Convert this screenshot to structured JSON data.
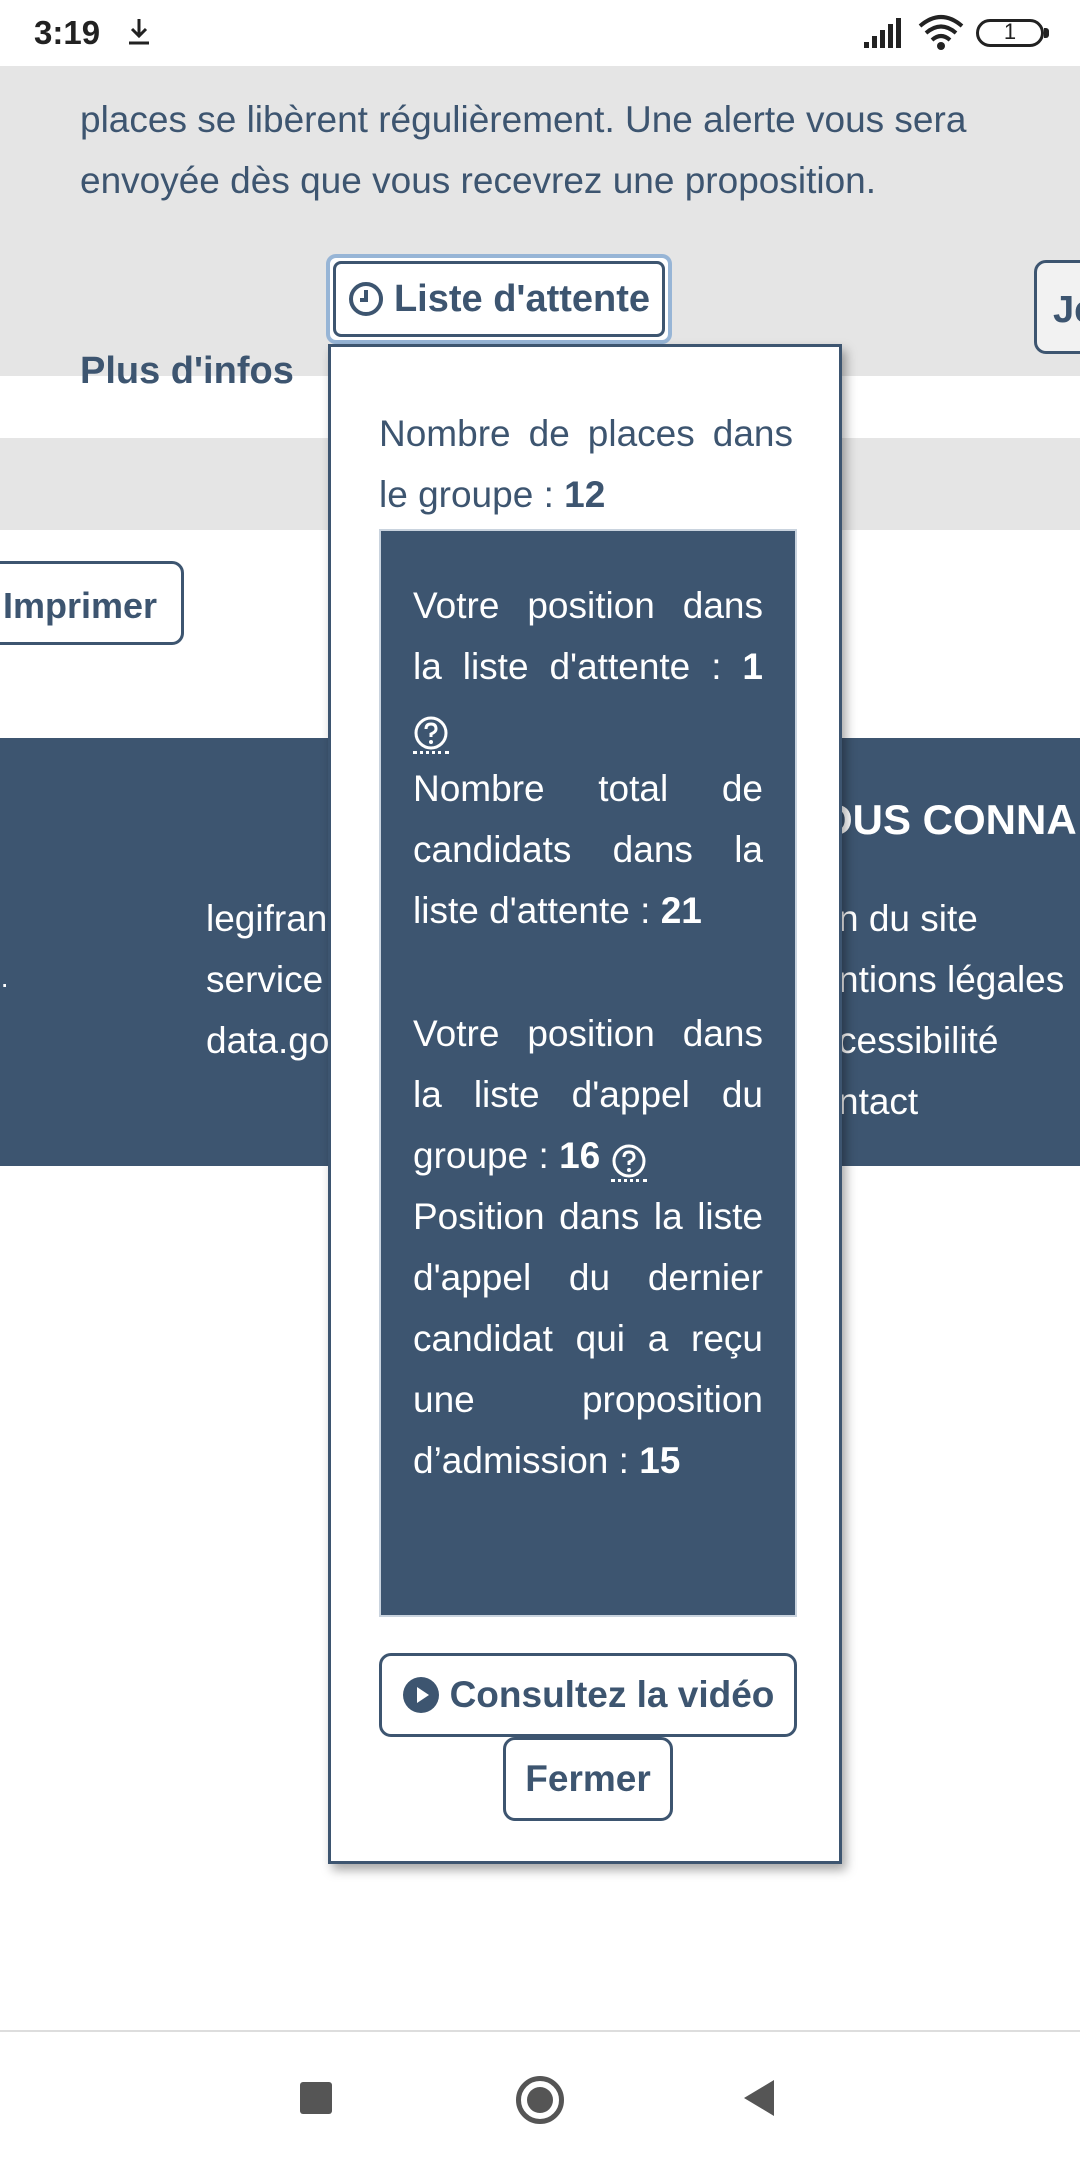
{
  "status_bar": {
    "time": "3:19",
    "battery": "1"
  },
  "info": {
    "text": "places se libèrent régulièrement. Une alerte vous sera envoyée dès que vous recevrez une proposition.",
    "more_label": "Plus d'infos",
    "liste_button": "Liste d'attente",
    "side_button_partial": "Je"
  },
  "imprimer_button": "Imprimer",
  "footer": {
    "heading_partial": "OUS CONNA",
    "left_links": [
      "legifran",
      "service",
      "data.go"
    ],
    "right_links": [
      "n du site",
      "ntions légales",
      "cessibilité",
      "ntact"
    ]
  },
  "popover": {
    "places_label": "Nombre de places dans le groupe :",
    "places_value": "12",
    "position_label": "Votre position dans la liste d'attente :",
    "position_value": "1",
    "total_label": "Nombre total de candidats dans la liste d'attente :",
    "total_value": "21",
    "call_label": "Votre position dans la liste d'appel du groupe :",
    "call_value": "16",
    "last_label": "Position dans la liste d'appel du dernier candidat qui a reçu une proposition d’admission :",
    "last_value": "15",
    "video_button": "Consultez la vidéo",
    "close_button": "Fermer"
  }
}
